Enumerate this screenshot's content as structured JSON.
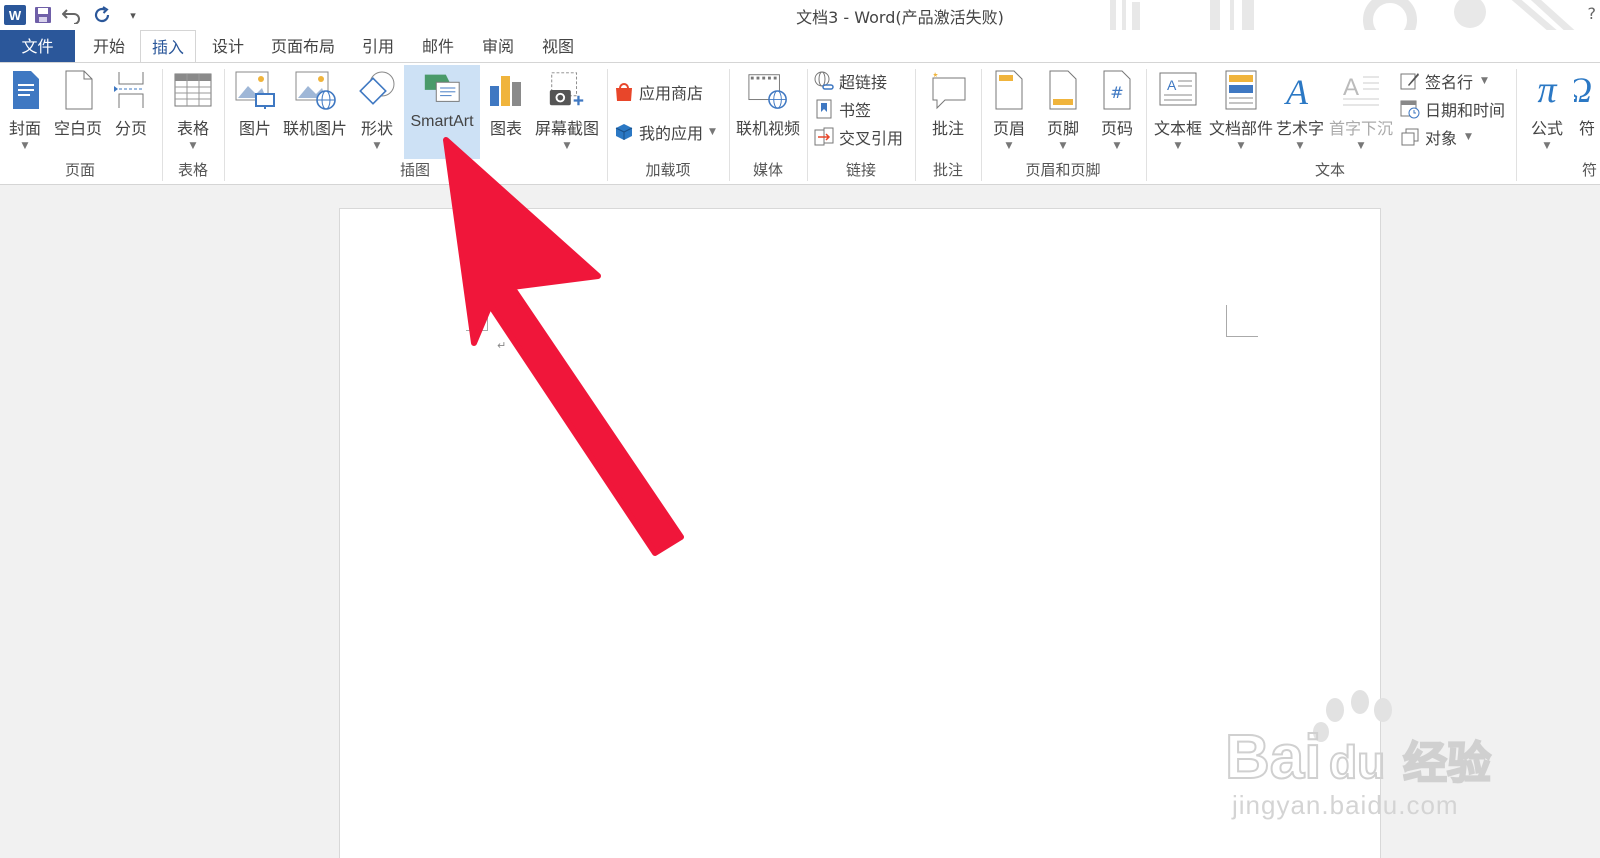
{
  "window": {
    "title": "文档3 - Word(产品激活失败)",
    "help": "?"
  },
  "qat": {
    "word_icon": "W",
    "save_icon": "save-icon",
    "undo_icon": "undo-icon",
    "redo_icon": "redo-icon",
    "customize_icon": "customize-qat-icon"
  },
  "tabs": [
    {
      "label": "文件"
    },
    {
      "label": "开始"
    },
    {
      "label": "插入"
    },
    {
      "label": "设计"
    },
    {
      "label": "页面布局"
    },
    {
      "label": "引用"
    },
    {
      "label": "邮件"
    },
    {
      "label": "审阅"
    },
    {
      "label": "视图"
    }
  ],
  "active_tab": "插入",
  "ribbon": {
    "pages": {
      "cover": "封面",
      "blank": "空白页",
      "break": "分页",
      "group": "页面"
    },
    "tables": {
      "table": "表格",
      "group": "表格"
    },
    "illustrations": {
      "picture": "图片",
      "online_picture": "联机图片",
      "shapes": "形状",
      "smartart": "SmartArt",
      "chart": "图表",
      "screenshot": "屏幕截图",
      "group": "插图"
    },
    "addins": {
      "store": "应用商店",
      "my_apps": "我的应用",
      "group": "加载项"
    },
    "media": {
      "online_video": "联机视频",
      "group": "媒体"
    },
    "links": {
      "hyperlink": "超链接",
      "bookmark": "书签",
      "cross_ref": "交叉引用",
      "group": "链接"
    },
    "comments": {
      "comment": "批注",
      "group": "批注"
    },
    "header_footer": {
      "header": "页眉",
      "footer": "页脚",
      "page_number": "页码",
      "group": "页眉和页脚"
    },
    "text": {
      "textbox": "文本框",
      "quick_parts": "文档部件",
      "wordart": "艺术字",
      "dropcap": "首字下沉",
      "signature": "签名行",
      "datetime": "日期和时间",
      "object": "对象",
      "group": "文本"
    },
    "symbols": {
      "equation": "公式",
      "symbol": "符",
      "group": "符"
    }
  },
  "document": {
    "paragraph_mark": "↵"
  },
  "watermark": {
    "brand": "Bai",
    "brand2": "经验",
    "url": "jingyan.baidu.com"
  },
  "colors": {
    "accent": "#2b579a",
    "selected": "#cde1f5",
    "arrow": "#f0163a"
  }
}
